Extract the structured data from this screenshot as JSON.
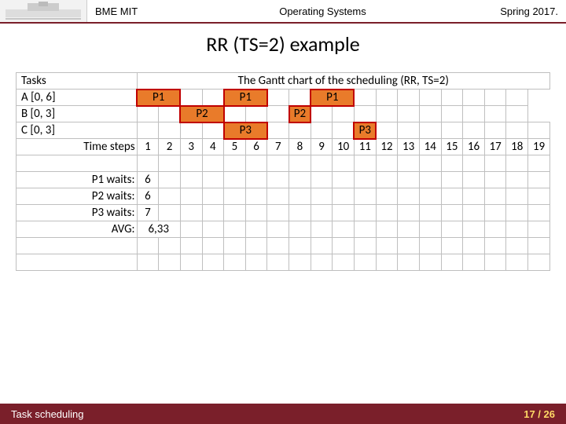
{
  "header": {
    "org": "BME MIT",
    "course": "Operating Systems",
    "term": "Spring 2017."
  },
  "title": "RR (TS=2) example",
  "table": {
    "col_tasks": "Tasks",
    "col_chart": "The Gantt chart of the scheduling (RR, TS=2)",
    "tasks": [
      {
        "name": "A [0, 6]",
        "label": "P1",
        "slots": [
          1,
          2,
          5,
          6,
          9,
          10
        ]
      },
      {
        "name": "B [0, 3]",
        "label": "P2",
        "slots": [
          3,
          4,
          8
        ]
      },
      {
        "name": "C [0, 3]",
        "label": "P3",
        "slots": [
          5,
          6,
          11
        ]
      }
    ],
    "timesteps_label": "Time steps",
    "timesteps": [
      "1",
      "2",
      "3",
      "4",
      "5",
      "6",
      "7",
      "8",
      "9",
      "10",
      "11",
      "12",
      "13",
      "14",
      "15",
      "16",
      "17",
      "18",
      "19"
    ],
    "waits": [
      {
        "label": "P1 waits:",
        "value": "6"
      },
      {
        "label": "P2 waits:",
        "value": "6"
      },
      {
        "label": "P3 waits:",
        "value": "7"
      }
    ],
    "avg_label": "AVG:",
    "avg_value": "6,33"
  },
  "chart_data": {
    "type": "table",
    "title": "RR (TS=2) Gantt chart and wait times",
    "time_range": [
      1,
      19
    ],
    "schedule": [
      {
        "task": "A",
        "process": "P1",
        "arrival": 0,
        "burst": 6,
        "running_steps": [
          [
            1,
            2
          ],
          [
            5,
            6
          ],
          [
            9,
            10
          ]
        ]
      },
      {
        "task": "B",
        "process": "P2",
        "arrival": 0,
        "burst": 3,
        "running_steps": [
          [
            3,
            4
          ],
          [
            8,
            8
          ]
        ]
      },
      {
        "task": "C",
        "process": "P3",
        "arrival": 0,
        "burst": 3,
        "running_steps": [
          [
            5,
            6
          ],
          [
            11,
            11
          ]
        ]
      }
    ],
    "wait_times": {
      "P1": 6,
      "P2": 6,
      "P3": 7
    },
    "avg_wait": 6.33
  },
  "footer": {
    "topic": "Task scheduling",
    "page": "17 / 26"
  }
}
